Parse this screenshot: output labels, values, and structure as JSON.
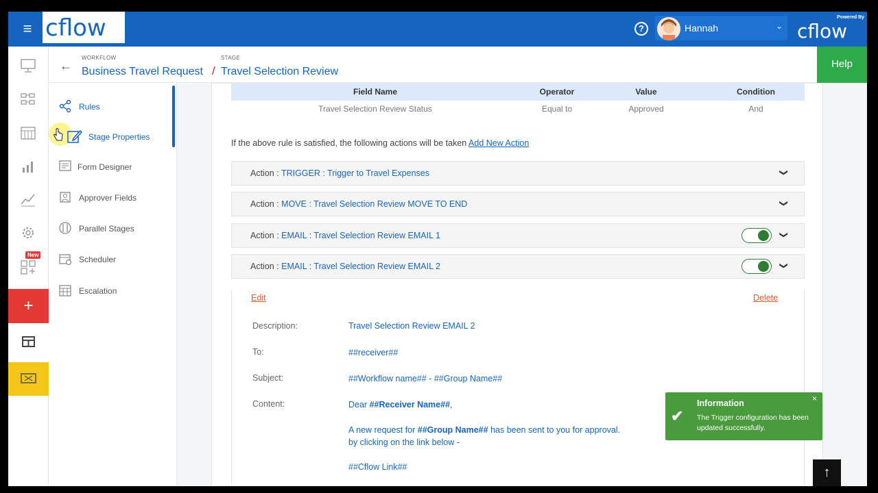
{
  "topbar": {
    "menu_icon": "hamburger-icon",
    "brand": "cflow",
    "help_icon": "question-circle-icon",
    "user_name": "Hannah",
    "user_caret": "⌄",
    "powered_by": "Powered By",
    "accent": "#1565c0"
  },
  "header": {
    "workflow_label": "WORKFLOW",
    "workflow_title": "Business Travel Request",
    "separator": "/",
    "stage_label": "STAGE",
    "stage_title": "Travel Selection Review",
    "help_label": "Help"
  },
  "rail": {
    "new_badge": "New",
    "add_symbol": "+",
    "icons": [
      "monitor-icon",
      "workflow-icon",
      "calendar-icon",
      "bar-chart-icon",
      "line-chart-icon",
      "gear-icon",
      "apps-icon",
      "add-icon",
      "table-icon",
      "ticket-icon"
    ]
  },
  "sidemenu": {
    "items": [
      {
        "label": "Rules",
        "icon": "share-icon"
      },
      {
        "label": "Stage Properties",
        "icon": "edit-icon"
      },
      {
        "label": "Form Designer",
        "icon": "form-icon"
      },
      {
        "label": "Approver Fields",
        "icon": "approver-icon"
      },
      {
        "label": "Parallel Stages",
        "icon": "parallel-icon"
      },
      {
        "label": "Scheduler",
        "icon": "scheduler-icon"
      },
      {
        "label": "Escalation",
        "icon": "escalation-icon"
      }
    ]
  },
  "rule_table": {
    "headers": [
      "Field Name",
      "Operator",
      "Value",
      "Condition"
    ],
    "row": [
      "Travel Selection Review Status",
      "Equal to",
      "Approved",
      "And"
    ]
  },
  "actions": {
    "intro": "If the above rule is satisfied, the following actions will be taken",
    "add_new": "Add New Action",
    "prefix": "Action :",
    "items": [
      {
        "label": "TRIGGER : Trigger to Travel Expenses",
        "toggle": false
      },
      {
        "label": "MOVE : Travel Selection Review MOVE TO END",
        "toggle": false
      },
      {
        "label": "EMAIL : Travel Selection Review EMAIL 1",
        "toggle": true
      },
      {
        "label": "EMAIL : Travel Selection Review EMAIL 2",
        "toggle": true
      }
    ]
  },
  "detail": {
    "edit": "Edit",
    "delete": "Delete",
    "description_label": "Description:",
    "description_value": "Travel Selection Review EMAIL 2",
    "to_label": "To:",
    "to_value": "##receiver##",
    "subject_label": "Subject:",
    "subject_value": "##Workflow name## - ##Group Name##",
    "content_label": "Content:",
    "content_greeting_pre": "Dear",
    "content_greeting_var": "##Receiver Name##",
    "content_greeting_post": ",",
    "content_line1_pre": "A new request for",
    "content_line1_var": "##Group Name##",
    "content_line1_post": "has been sent to you for approval.",
    "content_line2": "by clicking on the link below -",
    "content_link": "##Cflow Link##"
  },
  "toast": {
    "title": "Information",
    "message": "The Trigger configuration has been updated successfully.",
    "close": "×",
    "color": "#4a9b3e"
  },
  "scroll_top_icon": "arrow-up-icon"
}
